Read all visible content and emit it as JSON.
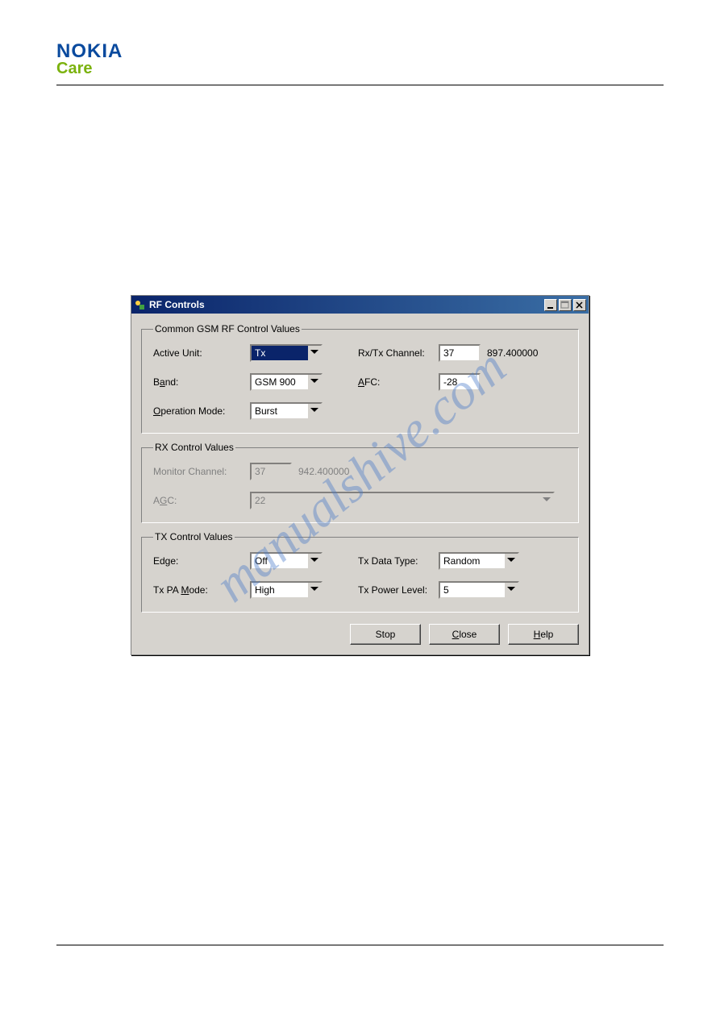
{
  "header": {
    "brand": "NOKIA",
    "sub": "Care"
  },
  "watermark": "manualshive.com",
  "window": {
    "title": "RF Controls",
    "group1": {
      "legend": "Common GSM RF Control Values",
      "active_unit_label": "Active Unit:",
      "active_unit_value": "Tx",
      "band_label_pre": "B",
      "band_label_u": "a",
      "band_label_post": "nd:",
      "band_value": "GSM 900",
      "op_label_pre": "",
      "op_label_u": "O",
      "op_label_post": "peration Mode:",
      "op_value": "Burst",
      "rxtx_label": "Rx/Tx Channel:",
      "rxtx_value": "37",
      "rxtx_freq": "897.400000",
      "afc_label_pre": "",
      "afc_label_u": "A",
      "afc_label_post": "FC:",
      "afc_value": "-28"
    },
    "group2": {
      "legend": "RX Control Values",
      "mon_label": "Monitor Channel:",
      "mon_value": "37",
      "mon_freq": "942.400000",
      "agc_label_pre": "A",
      "agc_label_u": "G",
      "agc_label_post": "C:",
      "agc_value": "22"
    },
    "group3": {
      "legend": "TX Control Values",
      "edge_label": "Edge:",
      "edge_value": "Off",
      "pa_label_pre": "Tx PA ",
      "pa_label_u": "M",
      "pa_label_post": "ode:",
      "pa_value": "High",
      "dtype_label": "Tx Data Type:",
      "dtype_value": "Random",
      "plvl_label": "Tx Power Level:",
      "plvl_value": "5"
    },
    "buttons": {
      "stop": "Stop",
      "close_pre": "",
      "close_u": "C",
      "close_post": "lose",
      "help_pre": "",
      "help_u": "H",
      "help_post": "elp"
    }
  }
}
